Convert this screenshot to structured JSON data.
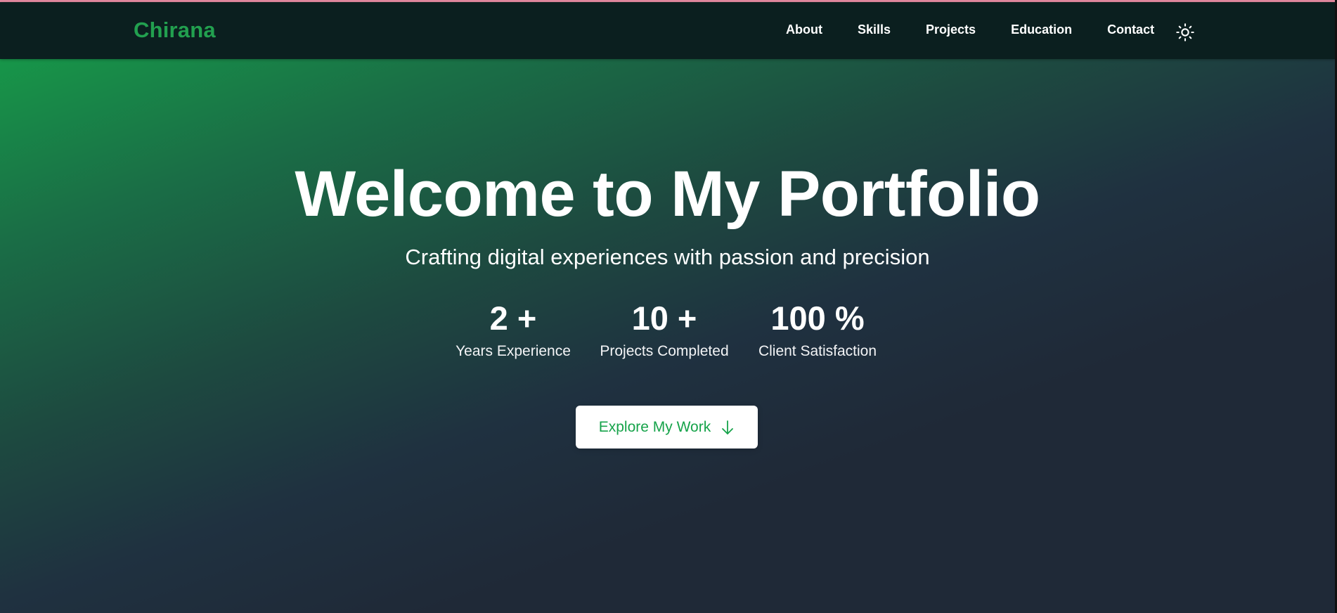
{
  "navbar": {
    "logo": "Chirana",
    "links": [
      {
        "label": "About"
      },
      {
        "label": "Skills"
      },
      {
        "label": "Projects"
      },
      {
        "label": "Education"
      },
      {
        "label": "Contact"
      }
    ],
    "theme_toggle_icon": "sun-icon"
  },
  "hero": {
    "title": "Welcome to My Portfolio",
    "subtitle": "Crafting digital experiences with passion and precision",
    "stats": [
      {
        "value": "2 +",
        "label": "Years Experience"
      },
      {
        "value": "10 +",
        "label": "Projects Completed"
      },
      {
        "value": "100 %",
        "label": "Client Satisfaction"
      }
    ],
    "cta": {
      "label": "Explore My Work",
      "icon": "arrow-down-icon"
    }
  },
  "colors": {
    "brand_green": "#16a34a",
    "nav_background": "#0b1f1f",
    "hero_dark": "#1f2937",
    "text_white": "#ffffff"
  }
}
